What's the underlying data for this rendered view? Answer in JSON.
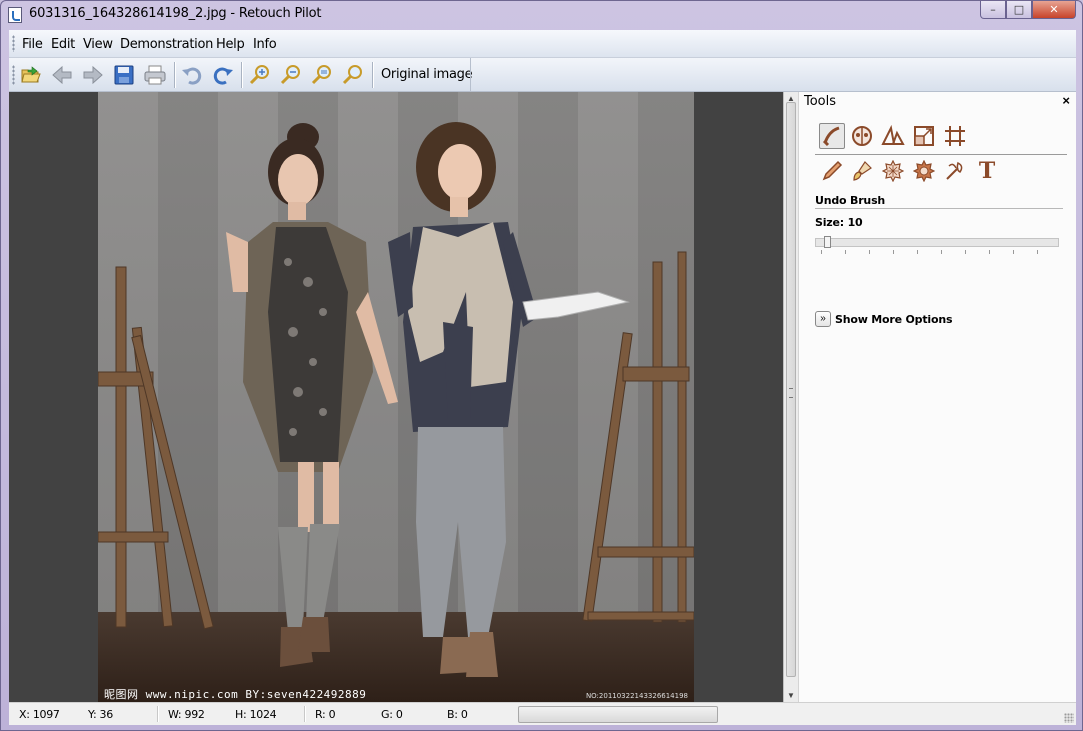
{
  "window": {
    "title": "6031316_164328614198_2.jpg - Retouch Pilot",
    "minimize": "–",
    "maximize": "□",
    "close": "✕"
  },
  "menu": [
    "File",
    "Edit",
    "View",
    "Demonstration",
    "Help",
    "Info"
  ],
  "toolbar": {
    "buttons": [
      "open-icon",
      "back-icon",
      "forward-icon",
      "save-icon",
      "print-icon",
      "undo-icon",
      "redo-icon",
      "zoom-in-icon",
      "zoom-out-icon",
      "zoom-fit-icon",
      "zoom-actual-icon"
    ],
    "original_image_label": "Original image"
  },
  "image": {
    "watermark_left": "昵图网 www.nipic.com   BY:seven422492889",
    "watermark_right": "NO:20110322143326614198"
  },
  "tools": {
    "title": "Tools",
    "close": "×",
    "row1": [
      "undo-brush-icon",
      "redeye-icon",
      "perspective-icon",
      "resize-icon",
      "crop-icon"
    ],
    "row2": [
      "pencil-icon",
      "brush-icon",
      "patch-icon",
      "stamp-icon",
      "wand-icon",
      "text-icon"
    ],
    "text_tool_glyph": "T",
    "section_title": "Undo Brush",
    "size_label": "Size: 10",
    "size_value": 10,
    "show_more_label": "Show More Options",
    "show_more_glyph": "»"
  },
  "status": {
    "x": "X: 1097",
    "y": "Y: 36",
    "w": "W: 992",
    "h": "H: 1024",
    "r": "R: 0",
    "g": "G: 0",
    "b": "B: 0"
  },
  "colors": {
    "accent_brown": "#8b4a2a",
    "canvas_bg": "#424242"
  }
}
